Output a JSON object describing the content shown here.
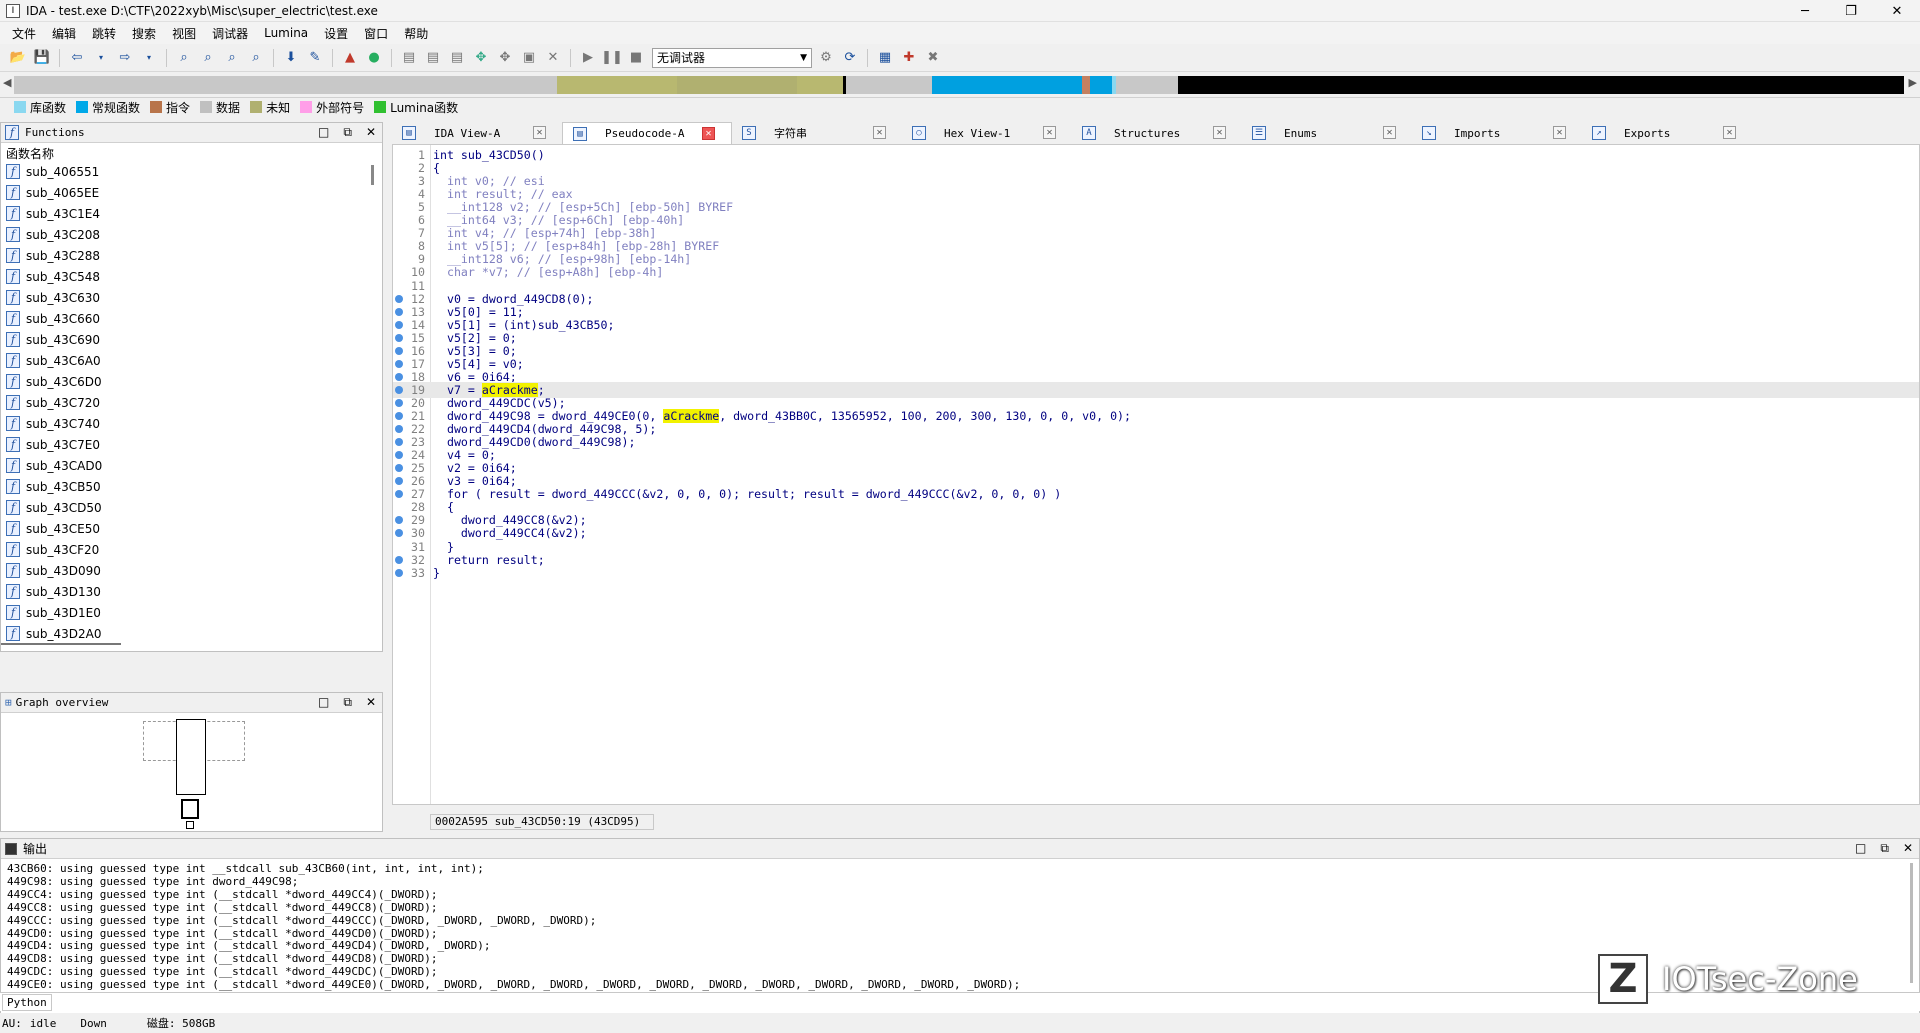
{
  "window": {
    "title": "IDA - test.exe D:\\CTF\\2022xyb\\Misc\\super_electric\\test.exe",
    "controls": [
      "─",
      "❐",
      "✕"
    ]
  },
  "menu": [
    "文件",
    "编辑",
    "跳转",
    "搜索",
    "视图",
    "调试器",
    "Lumina",
    "设置",
    "窗口",
    "帮助"
  ],
  "toolbar": {
    "debugger_select": "无调试器"
  },
  "legend": [
    {
      "label": "库函数",
      "color": "#8ad8f0"
    },
    {
      "label": "常规函数",
      "color": "#00a8e8"
    },
    {
      "label": "指令",
      "color": "#b8744a"
    },
    {
      "label": "数据",
      "color": "#c0c0c0"
    },
    {
      "label": "未知",
      "color": "#b0b070"
    },
    {
      "label": "外部符号",
      "color": "#ff9ee8"
    },
    {
      "label": "Lumina函数",
      "color": "#30c030"
    }
  ],
  "functions_panel": {
    "title": "Functions",
    "column_header": "函数名称",
    "items": [
      "sub_406551",
      "sub_4065EE",
      "sub_43C1E4",
      "sub_43C208",
      "sub_43C288",
      "sub_43C548",
      "sub_43C630",
      "sub_43C660",
      "sub_43C690",
      "sub_43C6A0",
      "sub_43C6D0",
      "sub_43C720",
      "sub_43C740",
      "sub_43C7E0",
      "sub_43CAD0",
      "sub_43CB50",
      "sub_43CD50",
      "sub_43CE50",
      "sub_43CF20",
      "sub_43D090",
      "sub_43D130",
      "sub_43D1E0",
      "sub_43D2A0"
    ]
  },
  "graph_panel": {
    "title": "Graph overview"
  },
  "tabs": [
    {
      "label": "IDA View-A",
      "icon": "ida-view-icon"
    },
    {
      "label": "Pseudocode-A",
      "icon": "pseudocode-icon"
    },
    {
      "label": "字符串",
      "icon": "strings-icon"
    },
    {
      "label": "Hex View-1",
      "icon": "hex-icon"
    },
    {
      "label": "Structures",
      "icon": "structures-icon"
    },
    {
      "label": "Enums",
      "icon": "enums-icon"
    },
    {
      "label": "Imports",
      "icon": "imports-icon"
    },
    {
      "label": "Exports",
      "icon": "exports-icon"
    }
  ],
  "code_lines": [
    "int sub_43CD50()",
    "{",
    "  int v0; // esi",
    "  int result; // eax",
    "  __int128 v2; // [esp+5Ch] [ebp-50h] BYREF",
    "  __int64 v3; // [esp+6Ch] [ebp-40h]",
    "  int v4; // [esp+74h] [ebp-38h]",
    "  int v5[5]; // [esp+84h] [ebp-28h] BYREF",
    "  __int128 v6; // [esp+98h] [ebp-14h]",
    "  char *v7; // [esp+A8h] [ebp-4h]",
    "",
    "  v0 = dword_449CD8(0);",
    "  v5[0] = 11;",
    "  v5[1] = (int)sub_43CB50;",
    "  v5[2] = 0;",
    "  v5[3] = 0;",
    "  v5[4] = v0;",
    "  v6 = 0i64;",
    "  v7 = aCrackme;",
    "  dword_449CDC(v5);",
    "  dword_449C98 = dword_449CE0(0, aCrackme, dword_43BB0C, 13565952, 100, 200, 300, 130, 0, 0, v0, 0);",
    "  dword_449CD4(dword_449C98, 5);",
    "  dword_449CD0(dword_449C98);",
    "  v4 = 0;",
    "  v2 = 0i64;",
    "  v3 = 0i64;",
    "  for ( result = dword_449CCC(&v2, 0, 0, 0); result; result = dword_449CCC(&v2, 0, 0, 0) )",
    "  {",
    "    dword_449CC8(&v2);",
    "    dword_449CC4(&v2);",
    "  }",
    "  return result;",
    "}"
  ],
  "code_status": "0002A595 sub_43CD50:19 (43CD95)",
  "output_panel": {
    "title": "输出",
    "lines": [
      "43CB60: using guessed type int __stdcall sub_43CB60(int, int, int, int);",
      "449C98: using guessed type int dword_449C98;",
      "449CC4: using guessed type int (__stdcall *dword_449CC4)(_DWORD);",
      "449CC8: using guessed type int (__stdcall *dword_449CC8)(_DWORD);",
      "449CCC: using guessed type int (__stdcall *dword_449CCC)(_DWORD, _DWORD, _DWORD, _DWORD);",
      "449CD0: using guessed type int (__stdcall *dword_449CD0)(_DWORD);",
      "449CD4: using guessed type int (__stdcall *dword_449CD4)(_DWORD, _DWORD);",
      "449CD8: using guessed type int (__stdcall *dword_449CD8)(_DWORD);",
      "449CDC: using guessed type int (__stdcall *dword_449CDC)(_DWORD);",
      "449CE0: using guessed type int (__stdcall *dword_449CE0)(_DWORD, _DWORD, _DWORD, _DWORD, _DWORD, _DWORD, _DWORD, _DWORD, _DWORD, _DWORD, _DWORD, _DWORD);"
    ]
  },
  "python_button": "Python",
  "status": {
    "au_label": "AU:",
    "au_state": "idle",
    "direction": "Down",
    "disk": "磁盘: 508GB"
  },
  "watermark": {
    "logo": "Z",
    "text": "IOTsec-Zone"
  }
}
